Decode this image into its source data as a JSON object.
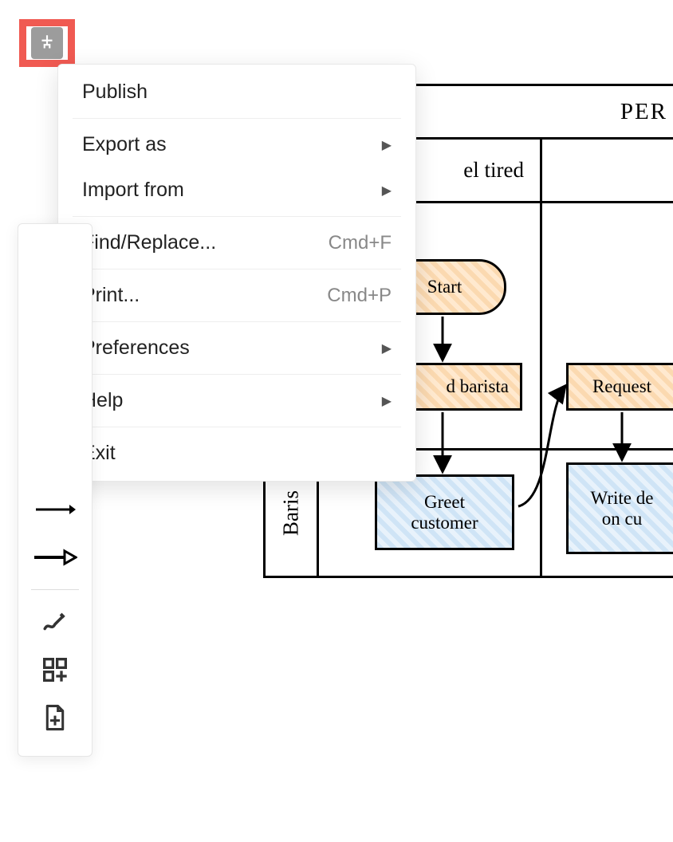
{
  "menu": {
    "publish": "Publish",
    "export_as": "Export as",
    "import_from": "Import from",
    "find_replace": "Find/Replace...",
    "find_replace_shortcut": "Cmd+F",
    "print": "Print...",
    "print_shortcut": "Cmd+P",
    "preferences": "Preferences",
    "help": "Help",
    "exit": "Exit"
  },
  "diagram": {
    "header_partial": "PER",
    "lane1_title_partial": "el tired",
    "lane2_label": "Baris",
    "nodes": {
      "start": "Start",
      "find_barista_partial": "d barista",
      "request_partial": "Request",
      "greet_customer": "Greet\ncustomer",
      "write_details_partial": "Write de\non cu"
    }
  }
}
